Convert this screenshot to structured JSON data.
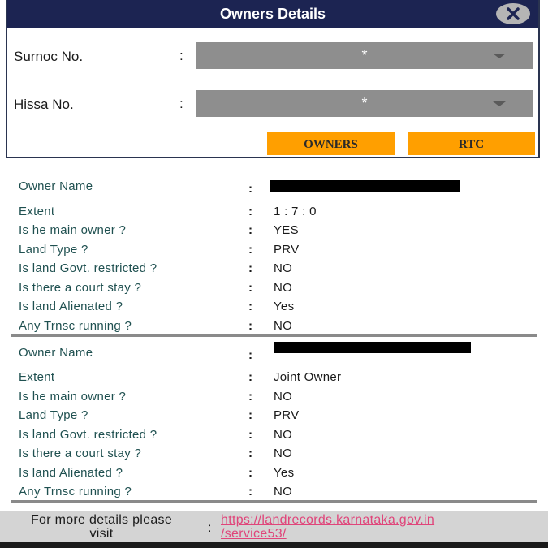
{
  "dialog": {
    "title": "Owners Details",
    "close_icon": "close-icon",
    "fields": [
      {
        "label": "Surnoc No.",
        "colon": ":",
        "value": "*"
      },
      {
        "label": "Hissa No.",
        "colon": ":",
        "value": "*"
      }
    ],
    "buttons": {
      "owners": "OWNERS",
      "rtc": "RTC"
    }
  },
  "owners": [
    {
      "rows": [
        {
          "key": "Owner Name",
          "value": "[redacted]"
        },
        {
          "key": "Extent",
          "value": "1 : 7 : 0"
        },
        {
          "key": "Is he main owner ?",
          "value": "YES"
        },
        {
          "key": "Land Type ?",
          "value": "PRV"
        },
        {
          "key": "Is land Govt. restricted ?",
          "value": "NO"
        },
        {
          "key": "Is there a court stay ?",
          "value": "NO"
        },
        {
          "key": "Is land Alienated ?",
          "value": "Yes"
        },
        {
          "key": "Any Trnsc running ?",
          "value": "NO"
        }
      ]
    },
    {
      "rows": [
        {
          "key": "Owner Name",
          "value": "[redacted]"
        },
        {
          "key": "Extent",
          "value": "Joint Owner"
        },
        {
          "key": "Is he main owner ?",
          "value": "NO"
        },
        {
          "key": "Land Type ?",
          "value": "PRV"
        },
        {
          "key": "Is land Govt. restricted ?",
          "value": "NO"
        },
        {
          "key": "Is there a court stay ?",
          "value": "NO"
        },
        {
          "key": "Is land Alienated ?",
          "value": "Yes"
        },
        {
          "key": "Any Trnsc running ?",
          "value": "NO"
        }
      ]
    }
  ],
  "colon": ":",
  "footer": {
    "label_line1": "For more details please",
    "label_line2": "visit",
    "colon": ":",
    "link_line1": "https://landrecords.karnataka.gov.in",
    "link_line2": "/service53/"
  },
  "colors": {
    "titlebar": "#1c2452",
    "button": "#ff9f00",
    "select": "#8e8e8e",
    "key_text": "#1f5050",
    "link": "#e0457a"
  }
}
